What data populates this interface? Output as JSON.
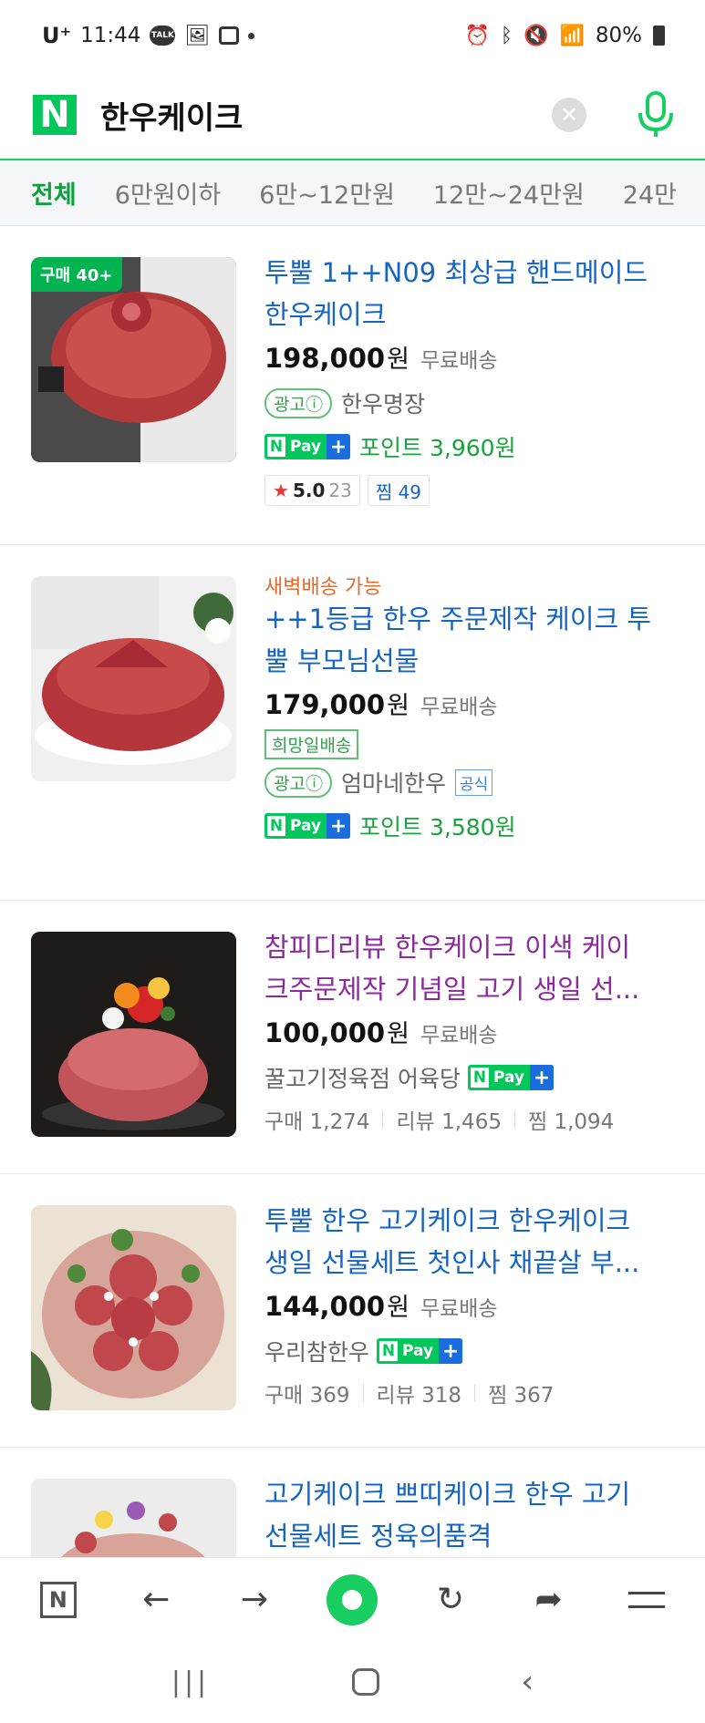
{
  "status_bar": {
    "carrier": "U⁺",
    "time": "11:44",
    "talk_badge": "TALK",
    "battery": "80%"
  },
  "search": {
    "logo": "N",
    "query": "한우케이크"
  },
  "tabs": [
    {
      "label": "전체",
      "active": true
    },
    {
      "label": "6만원이하",
      "active": false
    },
    {
      "label": "6만~12만원",
      "active": false
    },
    {
      "label": "12만~24만원",
      "active": false
    },
    {
      "label": "24만",
      "active": false
    }
  ],
  "products": [
    {
      "badge": "구매 40+",
      "title_line1": "투뿔 1++N09 최상급 핸드메이드",
      "title_line2": "한우케이크",
      "price": "198,000",
      "won": "원",
      "shipping": "무료배송",
      "ad_label": "광고ⓘ",
      "seller": "한우명장",
      "point": "포인트 3,960원",
      "rating": "5.0",
      "rating_count": "23",
      "zzim": "찜 49"
    },
    {
      "dawn": "새벽배송 가능",
      "title_line1": "++1등급 한우 주문제작 케이크 투",
      "title_line2": "뿔 부모님선물",
      "price": "179,000",
      "won": "원",
      "shipping": "무료배송",
      "hope": "희망일배송",
      "ad_label": "광고ⓘ",
      "seller": "엄마네한우",
      "official": "공식",
      "point": "포인트 3,580원"
    },
    {
      "title_line1": "참피디리뷰 한우케이크 이색 케이",
      "title_line2": "크주문제작 기념일 고기 생일 선...",
      "price": "100,000",
      "won": "원",
      "shipping": "무료배송",
      "seller": "꿀고기정육점 어육당",
      "stats": [
        "구매 1,274",
        "리뷰 1,465",
        "찜 1,094"
      ]
    },
    {
      "title_line1": "투뿔 한우 고기케이크 한우케이크",
      "title_line2": "생일 선물세트 첫인사 채끝살 부...",
      "price": "144,000",
      "won": "원",
      "shipping": "무료배송",
      "seller": "우리참한우",
      "stats": [
        "구매 369",
        "리뷰 318",
        "찜 367"
      ]
    },
    {
      "title_line1": "고기케이크 쁘띠케이크 한우 고기",
      "title_line2": "선물세트 정육의품격"
    }
  ],
  "npay": {
    "n": "N",
    "pay": "Pay",
    "plus": "+"
  },
  "bottom_bar": {
    "home": "N"
  },
  "colors": {
    "naver_green": "#03c75a",
    "title_blue": "#1565c0",
    "title_purple": "#8b2a9c",
    "point_green": "#18a33d"
  }
}
